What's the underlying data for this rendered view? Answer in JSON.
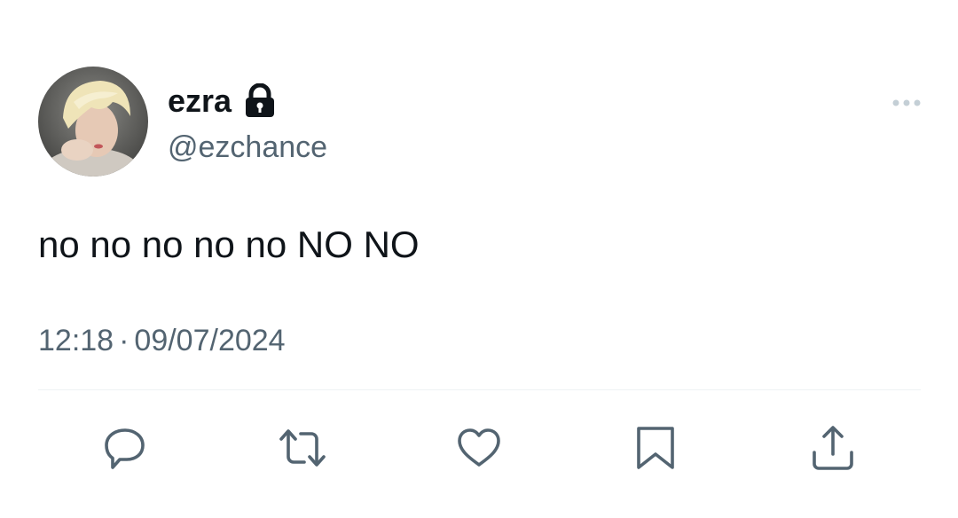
{
  "author": {
    "display_name": "ezra",
    "handle": "@ezchance",
    "protected": true,
    "avatar": "profile-photo"
  },
  "tweet": {
    "text": "no no no no no NO NO",
    "time": "12:18",
    "separator": "·",
    "date": "09/07/2024"
  },
  "actions": [
    {
      "name": "reply",
      "icon": "reply-icon"
    },
    {
      "name": "retweet",
      "icon": "retweet-icon"
    },
    {
      "name": "like",
      "icon": "heart-icon"
    },
    {
      "name": "bookmark",
      "icon": "bookmark-icon"
    },
    {
      "name": "share",
      "icon": "share-icon"
    }
  ],
  "colors": {
    "text_primary": "#0f1419",
    "text_secondary": "#536471",
    "divider": "#eff3f4",
    "icon": "#536471"
  }
}
